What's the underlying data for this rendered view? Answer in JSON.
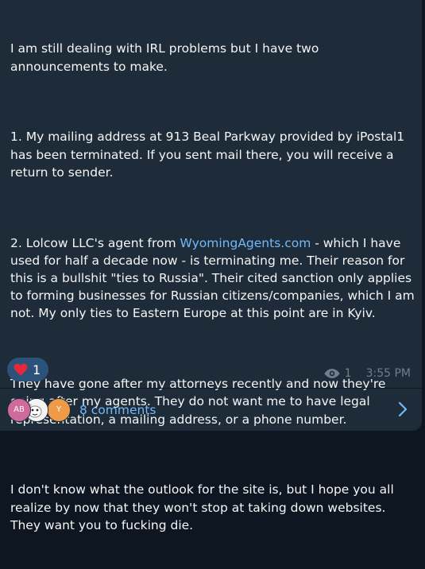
{
  "message": {
    "paragraphs": [
      {
        "text": "I am still dealing with IRL problems but I have two announcements to make."
      },
      {
        "text": "1. My mailing address at 913 Beal Parkway provided by iPostal1 has been terminated. If you sent mail there, you will receive a return to sender."
      },
      {
        "pre": "2. Lolcow LLC's agent from ",
        "link": "WyomingAgents.com",
        "post": " - which I have used for half a decade now - is terminating me. Their reason for this is a bullshit \"ties to Russia\". Their cited sanction only applies to forming businesses for Russian citizens/companies, which I am not. My only ties to Eastern Europe at this point are in Kyiv."
      },
      {
        "text": "They have gone after my attorneys recently and now they're going after my agents. They do not want me to have legal representation, a mailing address, or a phone number."
      },
      {
        "text": "I don't know what the outlook for the site is, but I hope you all realize by now that they won't stop at taking down websites. They want you to fucking die."
      }
    ]
  },
  "reaction": {
    "icon": "heart-icon",
    "count": "1",
    "color": "#e5283b"
  },
  "meta": {
    "views": "1",
    "time": "3:55 PM"
  },
  "comments": {
    "avatars": [
      {
        "initials": "AB",
        "color": "#d06a9a"
      },
      {
        "initials": "",
        "color": "#f3f3f3"
      },
      {
        "initials": "Y",
        "color": "#ef9a46"
      }
    ],
    "label": "8 comments"
  },
  "colors": {
    "bubble": "#1e2c3a",
    "background": "#0e1621",
    "link": "#71baf8",
    "reaction_bg": "#2b5278"
  }
}
